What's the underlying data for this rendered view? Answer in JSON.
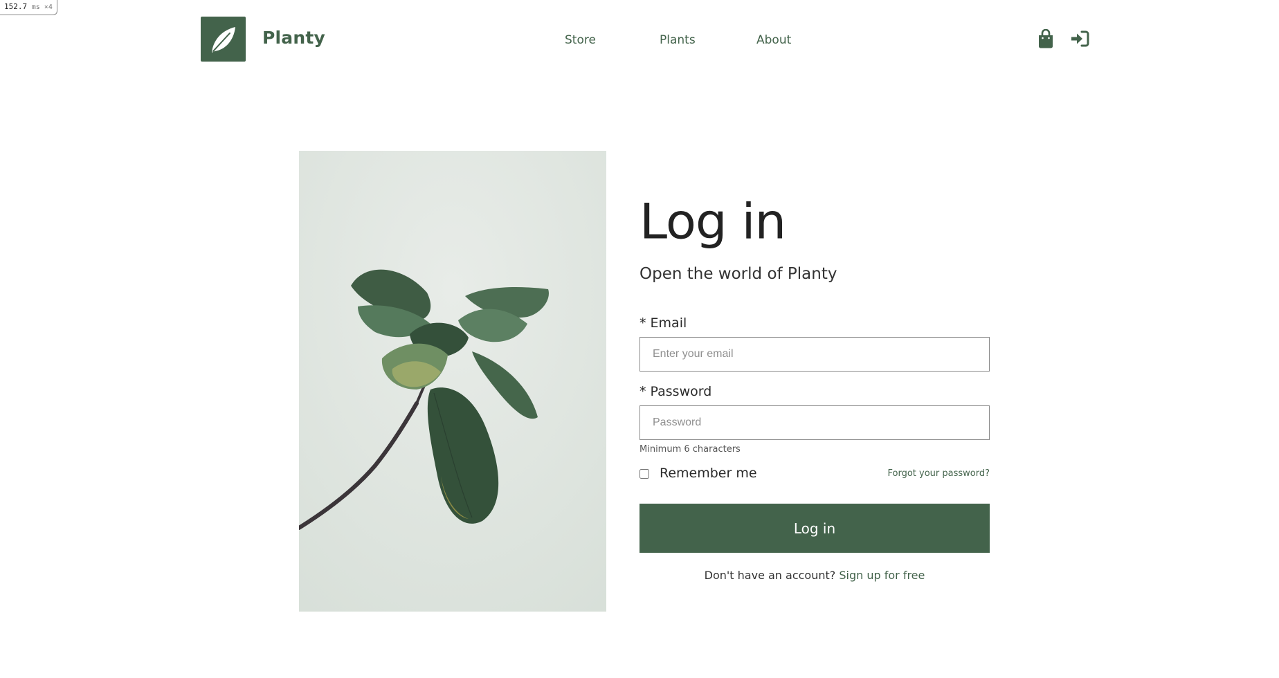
{
  "perf": {
    "value": "152.7",
    "unit": "ms ×4"
  },
  "header": {
    "brand": "Planty",
    "nav": [
      {
        "label": "Store"
      },
      {
        "label": "Plants"
      },
      {
        "label": "About"
      }
    ],
    "icons": [
      "shopping-bag-icon",
      "login-icon"
    ],
    "brand_color": "#43634b"
  },
  "hero_image": {
    "subject": "leaf-plant"
  },
  "form": {
    "title": "Log in",
    "subtitle": "Open the world of Planty",
    "email": {
      "label": "* Email",
      "placeholder": "Enter your email",
      "value": ""
    },
    "password": {
      "label": "* Password",
      "placeholder": "Password",
      "value": "",
      "hint": "Minimum 6 characters"
    },
    "remember": {
      "label": "Remember me",
      "checked": false
    },
    "forgot": "Forgot your password?",
    "submit": "Log in",
    "signup": {
      "prompt": "Don't have an account?",
      "link": "Sign up for free"
    }
  }
}
